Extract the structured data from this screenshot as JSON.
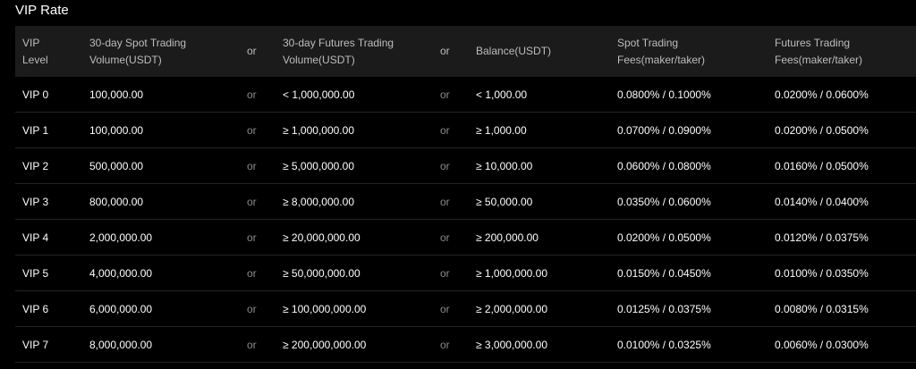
{
  "title": "VIP Rate",
  "columns": {
    "level_line1": "VIP",
    "level_line2": "Level",
    "spot_volume_line1": "30-day Spot Trading",
    "spot_volume_line2": "Volume(USDT)",
    "or1": "or",
    "futures_volume_line1": "30-day Futures Trading",
    "futures_volume_line2": "Volume(USDT)",
    "or2": "or",
    "balance": "Balance(USDT)",
    "spot_fees_line1": "Spot Trading",
    "spot_fees_line2": "Fees(maker/taker)",
    "futures_fees_line1": "Futures Trading",
    "futures_fees_line2": "Fees(maker/taker)"
  },
  "rows": [
    {
      "level": "VIP 0",
      "spot_volume": "100,000.00",
      "or1": "or",
      "futures_volume": "< 1,000,000.00",
      "or2": "or",
      "balance": "< 1,000.00",
      "spot_fees": "0.0800% / 0.1000%",
      "futures_fees": "0.0200% / 0.0600%"
    },
    {
      "level": "VIP 1",
      "spot_volume": "100,000.00",
      "or1": "or",
      "futures_volume": "≥ 1,000,000.00",
      "or2": "or",
      "balance": "≥ 1,000.00",
      "spot_fees": "0.0700% / 0.0900%",
      "futures_fees": "0.0200% / 0.0500%"
    },
    {
      "level": "VIP 2",
      "spot_volume": "500,000.00",
      "or1": "or",
      "futures_volume": "≥ 5,000,000.00",
      "or2": "or",
      "balance": "≥ 10,000.00",
      "spot_fees": "0.0600% / 0.0800%",
      "futures_fees": "0.0160% / 0.0500%"
    },
    {
      "level": "VIP 3",
      "spot_volume": "800,000.00",
      "or1": "or",
      "futures_volume": "≥ 8,000,000.00",
      "or2": "or",
      "balance": "≥ 50,000.00",
      "spot_fees": "0.0350% / 0.0600%",
      "futures_fees": "0.0140% / 0.0400%"
    },
    {
      "level": "VIP 4",
      "spot_volume": "2,000,000.00",
      "or1": "or",
      "futures_volume": "≥ 20,000,000.00",
      "or2": "or",
      "balance": "≥ 200,000.00",
      "spot_fees": "0.0200% / 0.0500%",
      "futures_fees": "0.0120% / 0.0375%"
    },
    {
      "level": "VIP 5",
      "spot_volume": "4,000,000.00",
      "or1": "or",
      "futures_volume": "≥ 50,000,000.00",
      "or2": "or",
      "balance": "≥ 1,000,000.00",
      "spot_fees": "0.0150% / 0.0450%",
      "futures_fees": "0.0100% / 0.0350%"
    },
    {
      "level": "VIP 6",
      "spot_volume": "6,000,000.00",
      "or1": "or",
      "futures_volume": "≥ 100,000,000.00",
      "or2": "or",
      "balance": "≥ 2,000,000.00",
      "spot_fees": "0.0125% / 0.0375%",
      "futures_fees": "0.0080% / 0.0315%"
    },
    {
      "level": "VIP 7",
      "spot_volume": "8,000,000.00",
      "or1": "or",
      "futures_volume": "≥ 200,000,000.00",
      "or2": "or",
      "balance": "≥ 3,000,000.00",
      "spot_fees": "0.0100% / 0.0325%",
      "futures_fees": "0.0060% / 0.0300%"
    }
  ],
  "colors": {
    "background": "#000000",
    "header_background": "#1b1b1b",
    "header_text": "#bdbdbd",
    "row_text": "#ffffff",
    "or_text": "#8a8a8a",
    "row_divider": "#232323"
  }
}
